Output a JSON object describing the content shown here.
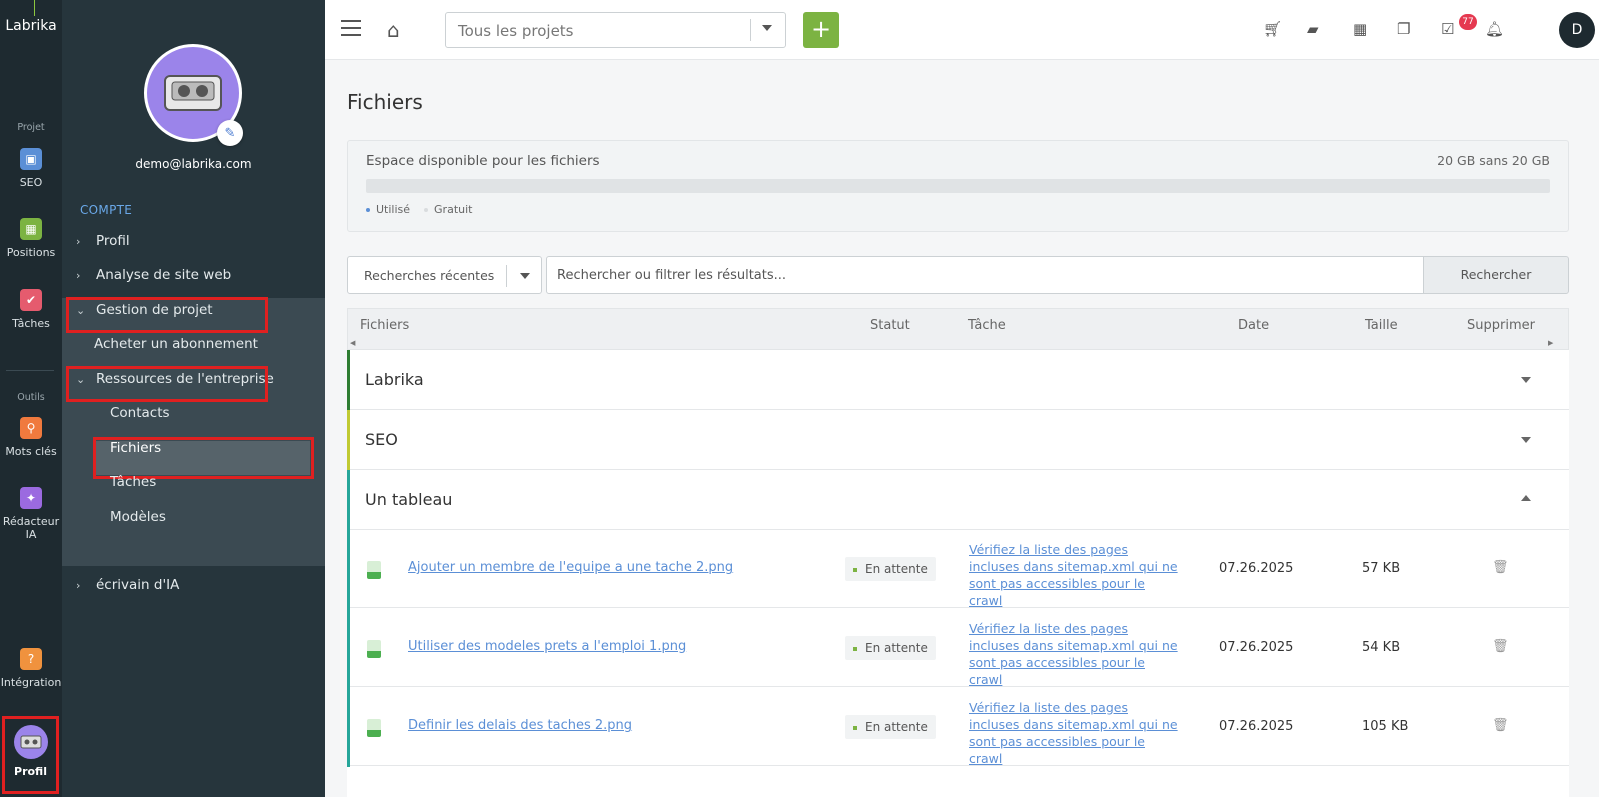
{
  "rail": {
    "logo": "Labrika",
    "section_project": "Projet",
    "section_tools": "Outils",
    "items": [
      {
        "label": "SEO",
        "icon": "seo-icon",
        "color": "#5b8fd6"
      },
      {
        "label": "Positions",
        "icon": "chart-icon",
        "color": "#7cb342"
      },
      {
        "label": "Tâches",
        "icon": "check-icon",
        "color": "#e55b6e"
      },
      {
        "label": "Mots clés",
        "icon": "key-icon",
        "color": "#f07a3e"
      },
      {
        "label": "Rédacteur IA",
        "icon": "magic-wand-icon",
        "color": "#9b6ae0"
      },
      {
        "label": "Intégration",
        "icon": "help-icon",
        "color": "#f0923e"
      }
    ],
    "profile_label": "Profil"
  },
  "sidebar": {
    "email": "demo@labrika.com",
    "heading": "COMPTE",
    "items": {
      "profil": "Profil",
      "analyse": "Analyse de site web",
      "gestion": "Gestion de projet",
      "abonnement": "Acheter un abonnement",
      "ressources": "Ressources de l'entreprise",
      "contacts": "Contacts",
      "fichiers": "Fichiers",
      "taches": "Tâches",
      "modeles": "Modèles",
      "ecrivain": "écrivain d'IA"
    }
  },
  "topbar": {
    "project_select": "Tous les projets",
    "notifications_count": "77",
    "user_initial": "D"
  },
  "page": {
    "title": "Fichiers",
    "storage": {
      "label": "Espace disponible pour les fichiers",
      "capacity": "20 GB sans 20 GB",
      "legend_used": "Utilisé",
      "legend_free": "Gratuit",
      "used_fraction": 0,
      "used_color": "#5b8fd6",
      "free_color": "#d9dcde"
    },
    "search": {
      "recent_label": "Recherches récentes",
      "placeholder": "Rechercher ou filtrer les résultats...",
      "button": "Rechercher"
    },
    "table": {
      "headers": {
        "files": "Fichiers",
        "status": "Statut",
        "task": "Tâche",
        "date": "Date",
        "size": "Taille",
        "delete": "Supprimer"
      },
      "groups": [
        {
          "name": "Labrika",
          "color": "#2e7d32",
          "expanded": false
        },
        {
          "name": "SEO",
          "color": "#c0ca33",
          "expanded": false
        },
        {
          "name": "Un tableau",
          "color": "#26a69a",
          "expanded": true
        }
      ],
      "rows": [
        {
          "file": "Ajouter un membre de l'equipe a une tache 2.png",
          "status": "En attente",
          "task": "Vérifiez la liste des pages incluses dans sitemap.xml qui ne sont pas accessibles pour le crawl",
          "date": "07.26.2025",
          "size": "57 KB"
        },
        {
          "file": "Utiliser des modeles prets a l'emploi 1.png",
          "status": "En attente",
          "task": "Vérifiez la liste des pages incluses dans sitemap.xml qui ne sont pas accessibles pour le crawl",
          "date": "07.26.2025",
          "size": "54 KB"
        },
        {
          "file": "Definir les delais des taches 2.png",
          "status": "En attente",
          "task": "Vérifiez la liste des pages incluses dans sitemap.xml qui ne sont pas accessibles pour le crawl",
          "date": "07.26.2025",
          "size": "105 KB"
        }
      ]
    }
  }
}
